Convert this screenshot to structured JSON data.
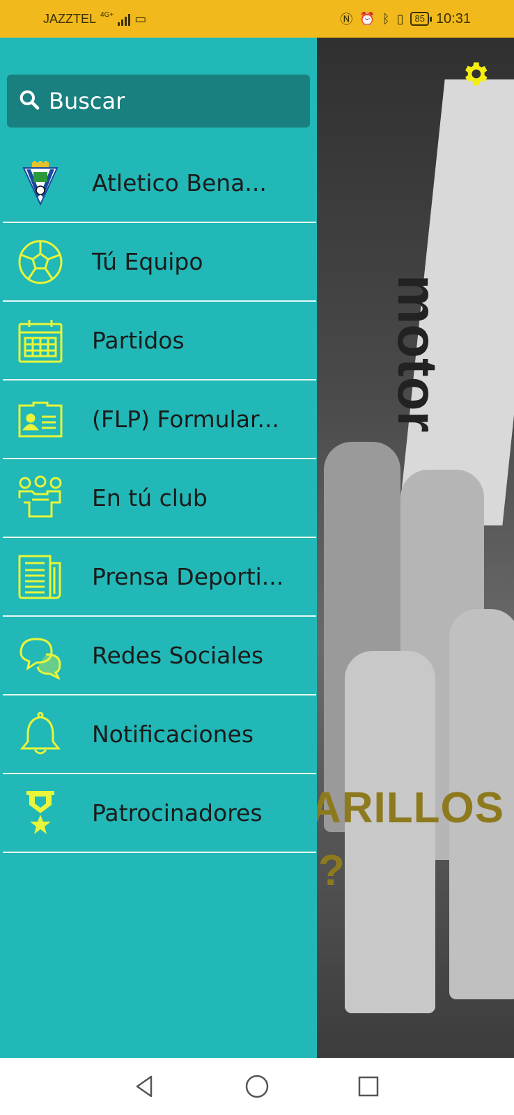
{
  "status_bar": {
    "carrier": "JAZZTEL",
    "network": "4G+",
    "battery": "85",
    "time": "10:31"
  },
  "background": {
    "banner_text": "motor",
    "headline": "ARILLOS",
    "headline2": "?"
  },
  "drawer": {
    "search": {
      "label": "Buscar",
      "icon": "search-icon"
    },
    "items": [
      {
        "label": "Atletico Bena...",
        "icon": "club-crest-icon"
      },
      {
        "label": "Tú Equipo",
        "icon": "soccer-ball-icon"
      },
      {
        "label": "Partidos",
        "icon": "calendar-icon"
      },
      {
        "label": "(FLP) Formular...",
        "icon": "id-card-icon"
      },
      {
        "label": "En tú club",
        "icon": "group-icon"
      },
      {
        "label": "Prensa Deporti...",
        "icon": "newspaper-icon"
      },
      {
        "label": "Redes Sociales",
        "icon": "chat-bubbles-icon"
      },
      {
        "label": "Notificaciones",
        "icon": "bell-icon"
      },
      {
        "label": "Patrocinadores",
        "icon": "medal-icon"
      }
    ]
  },
  "colors": {
    "drawer_bg": "#21b8b7",
    "search_bg": "#19807f",
    "icon_accent": "#e8f53a",
    "status_bar": "#f2b91c"
  }
}
